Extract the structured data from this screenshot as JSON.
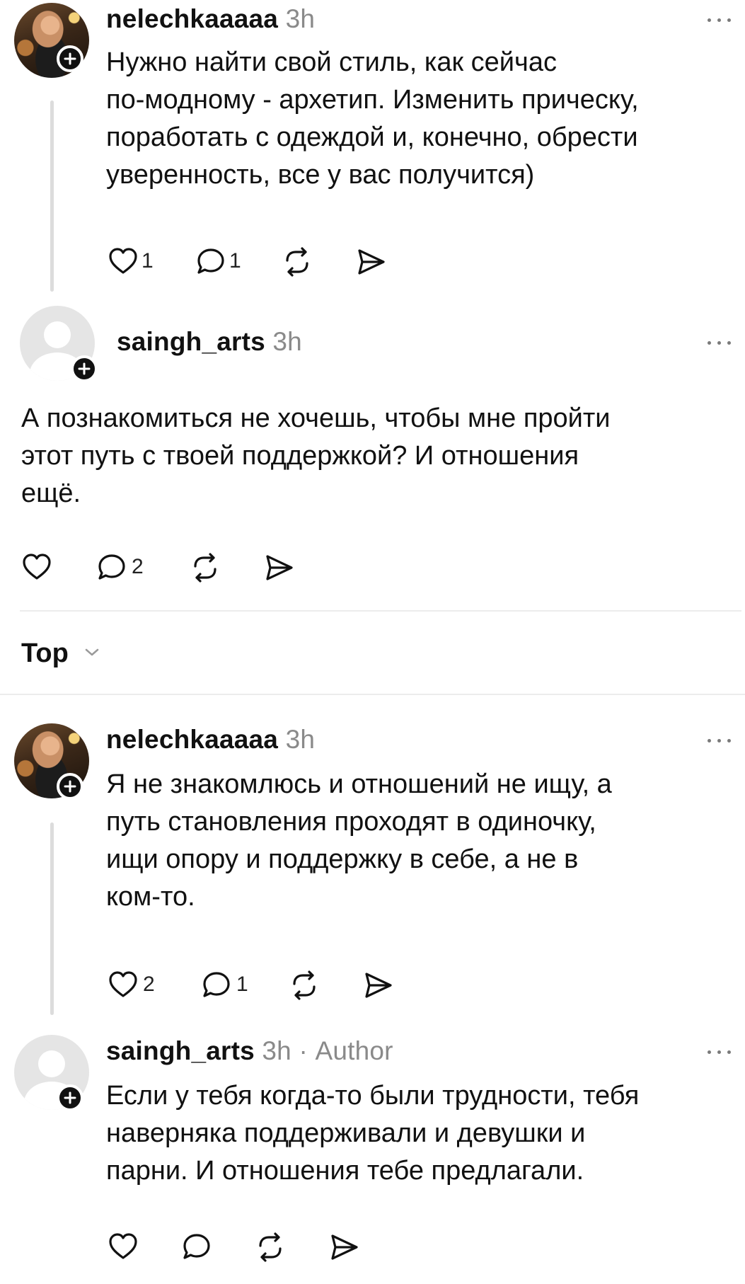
{
  "comments": [
    {
      "username": "nelechkaaaaa",
      "time": "3h",
      "text": "Нужно найти свой стиль, как сейчас\nпо-модному - архетип. Изменить прическу,\nпоработать с одеждой и, конечно, обрести\nуверенность, все у вас получится)",
      "likes": "1",
      "replies": "1"
    },
    {
      "username": "saingh_arts",
      "time": "3h",
      "text": "А познакомиться не хочешь, чтобы мне пройти\nэтот путь с твоей поддержкой? И отношения\nещё.",
      "likes": "",
      "replies": "2"
    }
  ],
  "sort": {
    "label": "Top"
  },
  "replies_section": [
    {
      "username": "nelechkaaaaa",
      "time": "3h",
      "text": "Я не знакомлюсь и отношений не ищу, а\nпуть становления проходят в одиночку,\nищи опору и поддержку в себе, а не в\nком-то.",
      "likes": "2",
      "replies": "1"
    },
    {
      "username": "saingh_arts",
      "time": "3h",
      "badge": "Author",
      "text": "Если у тебя когда-то были трудности, тебя\nнаверняка поддерживали и девушки и\nпарни. И отношения тебе предлагали.",
      "likes": "",
      "replies": ""
    }
  ],
  "icons": [
    "heart-icon",
    "comment-icon",
    "repost-icon",
    "send-icon",
    "more-icon",
    "plus-icon",
    "chevron-down-icon"
  ]
}
